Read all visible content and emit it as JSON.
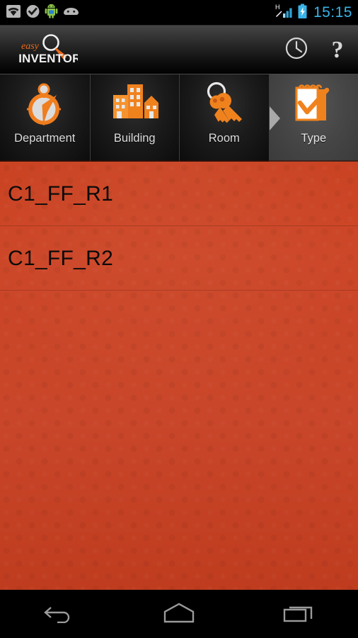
{
  "statusbar": {
    "time": "15:15",
    "network_type": "H",
    "left_icons": [
      "wifi-icon",
      "check-badge-icon",
      "android-robot-icon",
      "android-face-icon"
    ],
    "right_icons": [
      "signal-bars-icon",
      "battery-charging-icon"
    ],
    "clock_color": "#3ab4e8"
  },
  "actionbar": {
    "logo_line1": "easy",
    "logo_line2": "INVENTORY",
    "history_label": "History",
    "help_label": "?",
    "accent_color": "#e8691c"
  },
  "tabs": [
    {
      "label": "Department",
      "icon": "compass-icon",
      "active": false
    },
    {
      "label": "Building",
      "icon": "buildings-icon",
      "active": false
    },
    {
      "label": "Room",
      "icon": "keys-icon",
      "active": false
    },
    {
      "label": "Type",
      "icon": "checklist-notepad-icon",
      "active": true
    }
  ],
  "list": {
    "items": [
      {
        "label": "C1_FF_R1"
      },
      {
        "label": "C1_FF_R2"
      }
    ],
    "background_color": "#c9442a",
    "text_color": "#0b0b0b"
  },
  "navbar": {
    "buttons": [
      {
        "name": "back",
        "icon": "back-arrow-icon"
      },
      {
        "name": "home",
        "icon": "home-icon"
      },
      {
        "name": "recents",
        "icon": "recents-icon"
      }
    ]
  }
}
